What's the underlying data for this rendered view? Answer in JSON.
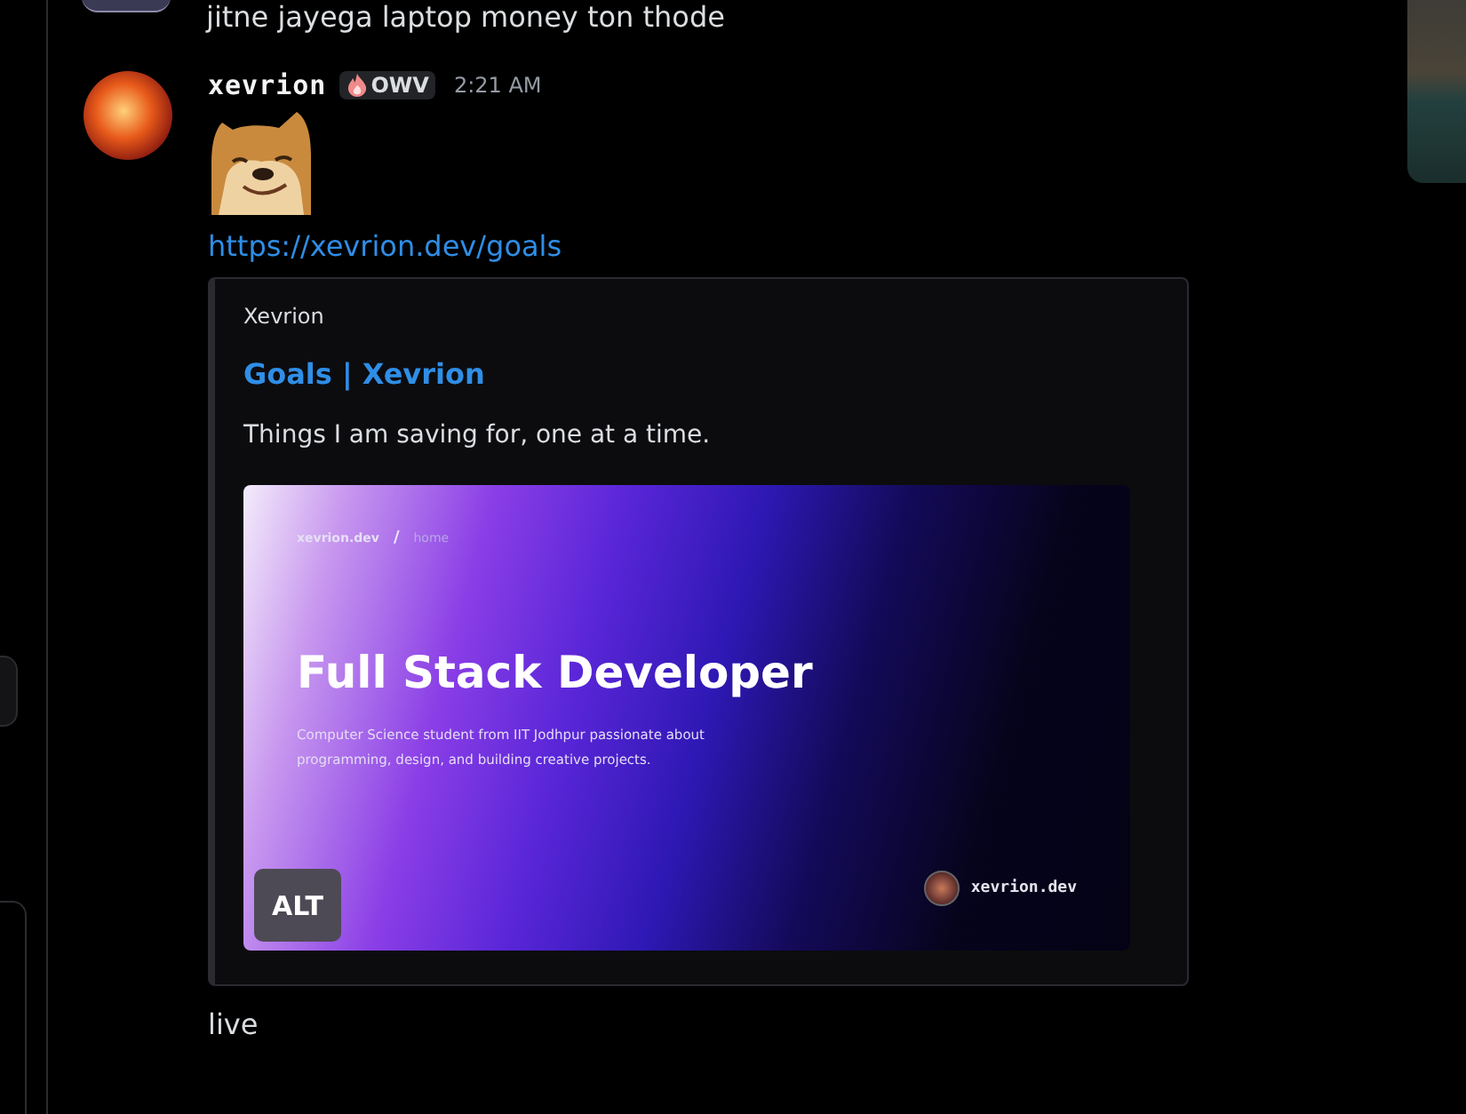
{
  "previous_message": {
    "text": "jitne jayega laptop money ton thode"
  },
  "message": {
    "author": "xevrion",
    "role_tag": {
      "label": "OWV"
    },
    "timestamp": "2:21 AM",
    "link": "https://xevrion.dev/goals",
    "embed": {
      "provider": "Xevrion",
      "title": "Goals | Xevrion",
      "description": "Things I am saving for, one at a time.",
      "preview": {
        "site": "xevrion.dev",
        "separator": "/",
        "breadcrumb": "home",
        "heading": "Full Stack Developer",
        "blurb": "Computer Science student from IIT Jodhpur passionate about programming, design, and building creative projects.",
        "footer_label": "xevrion.dev"
      },
      "alt_button": "ALT"
    }
  },
  "followup": {
    "text": "live"
  }
}
